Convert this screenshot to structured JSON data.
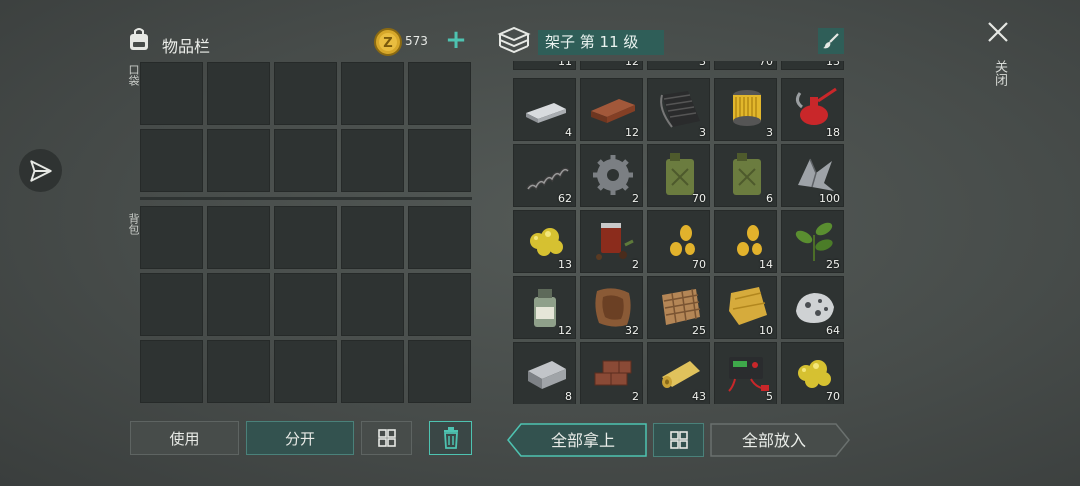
{
  "inventory": {
    "title": "物品栏",
    "coin_count": "573",
    "add_label": "+",
    "pocket_label": "口袋",
    "backpack_label": "背包",
    "pocket_slots": 10,
    "backpack_slots": 15
  },
  "buttons": {
    "use": "使用",
    "split": "分开",
    "take_all": "全部拿上",
    "put_all": "全部放入"
  },
  "shelf": {
    "title": "架子 第 11 级",
    "top_row_quantities": [
      "11",
      "12",
      "3",
      "70",
      "13"
    ],
    "items": [
      {
        "icon": "metal-bar-icon",
        "qty": "4"
      },
      {
        "icon": "brick-plank-icon",
        "qty": "12"
      },
      {
        "icon": "rubber-sheet-icon",
        "qty": "3"
      },
      {
        "icon": "filter-icon",
        "qty": "3"
      },
      {
        "icon": "oil-can-icon",
        "qty": "18"
      },
      {
        "icon": "spring-icon",
        "qty": "62"
      },
      {
        "icon": "gear-icon",
        "qty": "2"
      },
      {
        "icon": "jerrycan-icon",
        "qty": "70"
      },
      {
        "icon": "jerrycan-icon",
        "qty": "6"
      },
      {
        "icon": "scrap-metal-icon",
        "qty": "100"
      },
      {
        "icon": "gold-nugget-icon",
        "qty": "13"
      },
      {
        "icon": "spice-jar-icon",
        "qty": "2"
      },
      {
        "icon": "seeds-icon",
        "qty": "70"
      },
      {
        "icon": "seeds-icon",
        "qty": "14"
      },
      {
        "icon": "herb-icon",
        "qty": "25"
      },
      {
        "icon": "chemical-bottle-icon",
        "qty": "12"
      },
      {
        "icon": "hide-icon",
        "qty": "32"
      },
      {
        "icon": "snake-skin-icon",
        "qty": "25"
      },
      {
        "icon": "leather-icon",
        "qty": "10"
      },
      {
        "icon": "ore-icon",
        "qty": "64"
      },
      {
        "icon": "ingot-icon",
        "qty": "8"
      },
      {
        "icon": "bricks-icon",
        "qty": "2"
      },
      {
        "icon": "fabric-roll-icon",
        "qty": "43"
      },
      {
        "icon": "battery-charger-icon",
        "qty": "5"
      },
      {
        "icon": "gold-nugget-icon",
        "qty": "70"
      }
    ]
  },
  "close": {
    "label": "关闭"
  },
  "colors": {
    "accent": "#4ec3b1",
    "teal_panel": "#2f5e58",
    "cell": "#2e3332"
  }
}
